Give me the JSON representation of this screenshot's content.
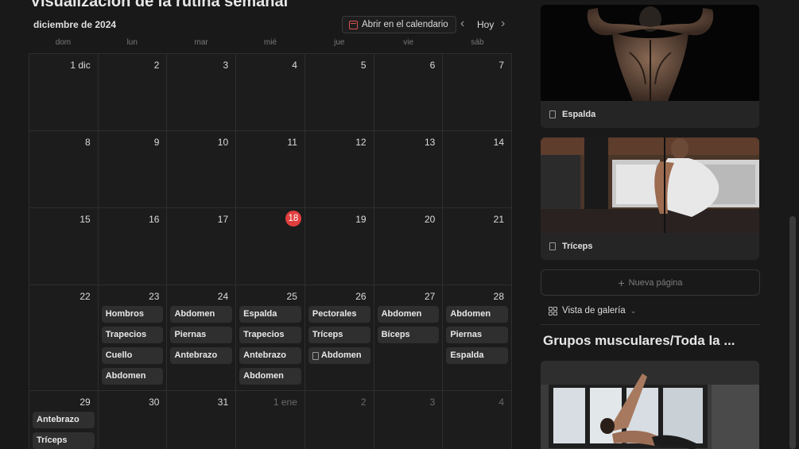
{
  "page": {
    "title": "Visualización de la rutina semanal"
  },
  "calendar": {
    "month": "diciembre de 2024",
    "open_button": "Abrir en el calendario",
    "today_button": "Hoy",
    "weekdays": [
      "dom",
      "lun",
      "mar",
      "mié",
      "jue",
      "vie",
      "sáb"
    ],
    "weeks": [
      [
        {
          "n": "1 dic"
        },
        {
          "n": "2"
        },
        {
          "n": "3"
        },
        {
          "n": "4"
        },
        {
          "n": "5"
        },
        {
          "n": "6"
        },
        {
          "n": "7"
        }
      ],
      [
        {
          "n": "8"
        },
        {
          "n": "9"
        },
        {
          "n": "10"
        },
        {
          "n": "11"
        },
        {
          "n": "12"
        },
        {
          "n": "13"
        },
        {
          "n": "14"
        }
      ],
      [
        {
          "n": "15"
        },
        {
          "n": "16"
        },
        {
          "n": "17"
        },
        {
          "n": "18",
          "today": true
        },
        {
          "n": "19"
        },
        {
          "n": "20"
        },
        {
          "n": "21"
        }
      ],
      [
        {
          "n": "22"
        },
        {
          "n": "23",
          "events": [
            "Hombros",
            "Trapecios",
            "Cuello",
            "Abdomen"
          ]
        },
        {
          "n": "24",
          "events": [
            "Abdomen",
            "Piernas",
            "Antebrazo"
          ]
        },
        {
          "n": "25",
          "events": [
            "Espalda",
            "Trapecios",
            "Antebrazo",
            "Abdomen"
          ]
        },
        {
          "n": "26",
          "events": [
            "Pectorales",
            "Tríceps",
            "Abdomen"
          ],
          "doc_event": 2
        },
        {
          "n": "27",
          "events": [
            "Abdomen",
            "Bíceps"
          ]
        },
        {
          "n": "28",
          "events": [
            "Abdomen",
            "Piernas",
            "Espalda"
          ]
        }
      ],
      [
        {
          "n": "29",
          "events": [
            "Antebrazo",
            "Tríceps"
          ]
        },
        {
          "n": "30"
        },
        {
          "n": "31"
        },
        {
          "n": "1 ene",
          "muted": true
        },
        {
          "n": "2",
          "muted": true
        },
        {
          "n": "3",
          "muted": true
        },
        {
          "n": "4",
          "muted": true
        }
      ]
    ]
  },
  "gallery": {
    "cards": [
      {
        "title": "Espalda",
        "icon": "page-icon"
      },
      {
        "title": "Tríceps",
        "icon": "page-icon"
      }
    ],
    "new_page": "Nueva página",
    "view_label": "Vista de galería",
    "section_title": "Grupos musculares/Toda la ..."
  },
  "colors": {
    "background": "#191919",
    "accent_today": "#e03e3e",
    "event_bg": "#2f2f2f"
  }
}
